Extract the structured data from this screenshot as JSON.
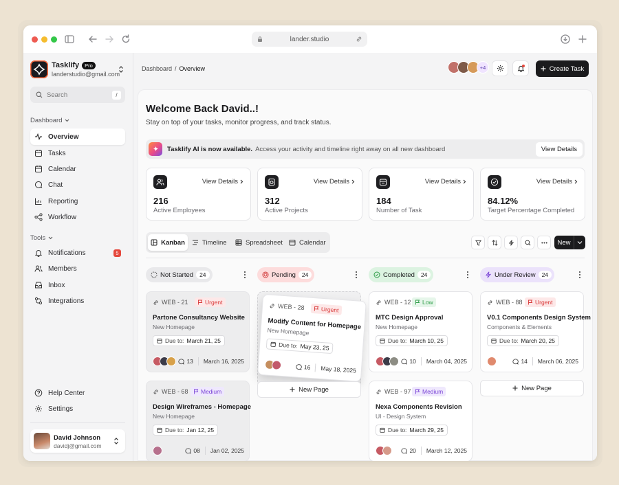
{
  "browser": {
    "url": "lander.studio"
  },
  "workspace": {
    "name": "Tasklify",
    "badge": "Pro",
    "email": "landerstudio@gmail.com"
  },
  "search": {
    "placeholder": "Search",
    "shortcut": "/"
  },
  "sidebar": {
    "dashboard_label": "Dashboard",
    "dashboard_items": [
      {
        "label": "Overview",
        "icon": "activity-icon"
      },
      {
        "label": "Tasks",
        "icon": "tasks-icon"
      },
      {
        "label": "Calendar",
        "icon": "calendar-icon"
      },
      {
        "label": "Chat",
        "icon": "chat-icon"
      },
      {
        "label": "Reporting",
        "icon": "chart-icon"
      },
      {
        "label": "Workflow",
        "icon": "workflow-icon"
      }
    ],
    "tools_label": "Tools",
    "tools_items": [
      {
        "label": "Notifications",
        "icon": "bell-icon",
        "badge": "5"
      },
      {
        "label": "Members",
        "icon": "members-icon"
      },
      {
        "label": "Inbox",
        "icon": "inbox-icon"
      },
      {
        "label": "Integrations",
        "icon": "integrations-icon"
      }
    ],
    "bottom_items": [
      {
        "label": "Help Center",
        "icon": "help-icon"
      },
      {
        "label": "Settings",
        "icon": "settings-icon"
      }
    ],
    "user": {
      "name": "David Johnson",
      "email": "davidj@gmail.com"
    }
  },
  "header": {
    "breadcrumb_root": "Dashboard",
    "breadcrumb_sep": "/",
    "breadcrumb_current": "Overview",
    "avatar_extra": "+4",
    "create_label": "Create Task"
  },
  "welcome": {
    "title": "Welcome Back David..!",
    "subtitle": "Stay on top of your tasks, monitor progress, and track status."
  },
  "banner": {
    "bold": "Tasklify AI is now available.",
    "text": "Access your activity and timeline right away on all new dashboard",
    "button": "View Details"
  },
  "stats": [
    {
      "value": "216",
      "label": "Active Employees",
      "link": "View Details"
    },
    {
      "value": "312",
      "label": "Active Projects",
      "link": "View Details"
    },
    {
      "value": "184",
      "label": "Number of Task",
      "link": "View Details"
    },
    {
      "value": "84.12%",
      "label": "Target Percentage Completed",
      "link": "View Details"
    }
  ],
  "views": [
    "Kanban",
    "Timeline",
    "Spreadsheet",
    "Calendar"
  ],
  "toolbar": {
    "new_label": "New"
  },
  "columns": [
    {
      "label": "Not Started",
      "count": "24",
      "color": "#e9e9eb"
    },
    {
      "label": "Pending",
      "count": "24",
      "color": "#fddcdc"
    },
    {
      "label": "Completed",
      "count": "24",
      "color": "#dcf3e1"
    },
    {
      "label": "Under Review",
      "count": "24",
      "color": "#ebe2fb"
    }
  ],
  "cards": {
    "c1": {
      "code": "WEB - 21",
      "priority": "Urgent",
      "title": "Partone Consultancy Website",
      "sub": "New Homepage",
      "due_label": "Due to:",
      "due": "March 21, 25",
      "comments": "13",
      "date": "March 16, 2025"
    },
    "c2": {
      "code": "WEB - 68",
      "priority": "Medium",
      "title": "Design Wireframes - Homepage",
      "sub": "New Homepage",
      "due_label": "Due to:",
      "due": "Jan 12, 25",
      "comments": "08",
      "date": "Jan 02, 2025"
    },
    "c3": {
      "code": "WEB - 28",
      "priority": "Urgent",
      "title": "Modify Content for Homepage",
      "sub": "New Homepage",
      "due_label": "Due to:",
      "due": "May 23, 25",
      "comments": "16",
      "date": "May 18, 2025"
    },
    "c4": {
      "code": "WEB - 12",
      "priority": "Low",
      "title": "MTC Design Approval",
      "sub": "New Homepage",
      "due_label": "Due to:",
      "due": "March 10, 25",
      "comments": "10",
      "date": "March 04, 2025"
    },
    "c5": {
      "code": "WEB - 97",
      "priority": "Medium",
      "title": "Nexa Components Revision",
      "sub": "UI - Design System",
      "due_label": "Due to:",
      "due": "March 29, 25",
      "comments": "20",
      "date": "March 12, 2025"
    },
    "c6": {
      "code": "WEB - 88",
      "priority": "Urgent",
      "title": "V0.1 Components Design System",
      "sub": "Components & Elements",
      "due_label": "Due to:",
      "due": "March 20, 25",
      "comments": "14",
      "date": "March 06, 2025"
    }
  },
  "new_page_label": "New Page"
}
